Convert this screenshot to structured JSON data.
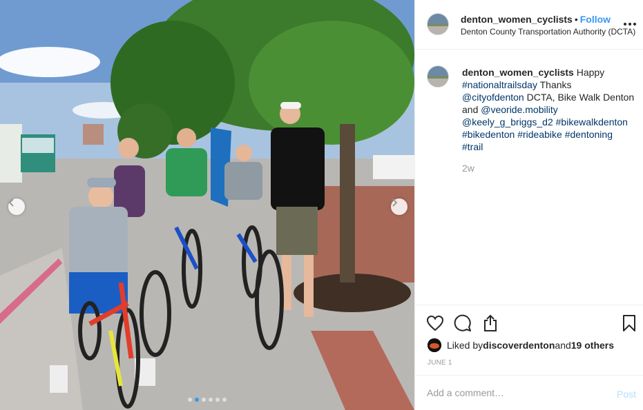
{
  "photo": {
    "alt_icons": {
      "prev": "chevron-left-icon",
      "next": "chevron-right-icon"
    },
    "carousel": {
      "count": 6,
      "active_index": 1
    }
  },
  "header": {
    "username": "denton_women_cyclists",
    "separator": "•",
    "follow_label": "Follow",
    "location": "Denton County Transportation Authority (DCTA)",
    "more_icon": "more-horizontal-icon"
  },
  "caption": {
    "username": "denton_women_cyclists",
    "text_1": " Happy ",
    "tag_1": "#nationaltrailsday",
    "text_2": " Thanks ",
    "mention_1": "@cityofdenton",
    "text_3": " DCTA, Bike Walk Denton and ",
    "mention_2": "@veoride.mobility",
    "text_4": " ",
    "mention_3": "@keely_g_briggs_d2",
    "text_5": " ",
    "tag_2": "#bikewalkdenton",
    "text_6": " ",
    "tag_3": "#bikedenton",
    "text_7": " ",
    "tag_4": "#rideabike",
    "text_8": " ",
    "tag_5": "#dentoning",
    "text_9": " ",
    "tag_6": "#trail",
    "time_ago": "2w"
  },
  "actions": {
    "like_icon": "heart-icon",
    "comment_icon": "comment-icon",
    "share_icon": "share-icon",
    "save_icon": "bookmark-icon"
  },
  "likes": {
    "prefix": "Liked by ",
    "liker": "discoverdenton",
    "middle": " and ",
    "others": "19 others"
  },
  "date": "JUNE 1",
  "comment": {
    "placeholder": "Add a comment…",
    "post_label": "Post"
  },
  "colors": {
    "link": "#003569",
    "accent": "#3897f0",
    "muted": "#999999",
    "post_disabled": "#b2dffc"
  }
}
